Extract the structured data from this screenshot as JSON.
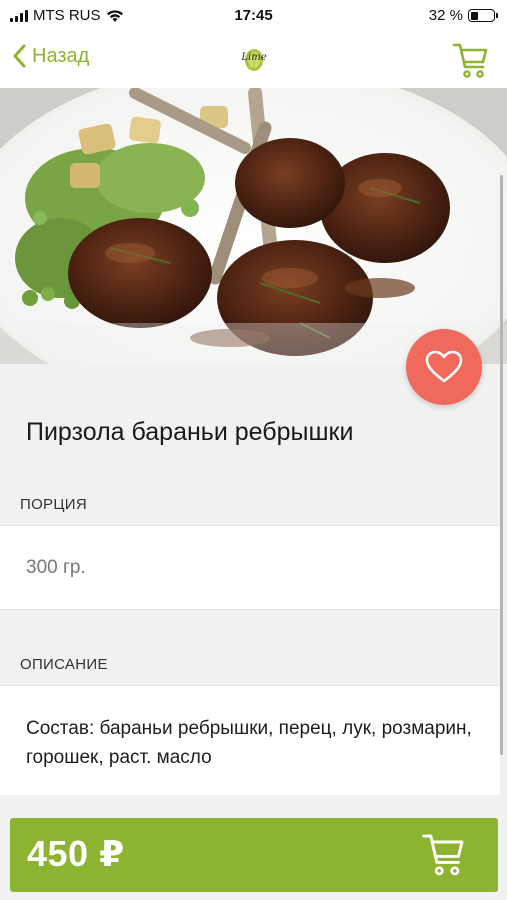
{
  "status_bar": {
    "carrier": "MTS RUS",
    "time": "17:45",
    "battery": "32 %",
    "battery_level": 0.32
  },
  "nav": {
    "back_label": "Назад",
    "logo_text": "Lime"
  },
  "product": {
    "title": "Пирзола бараньи ребрышки",
    "portion_label": "ПОРЦИЯ",
    "portion_value": "300 гр.",
    "description_label": "ОПИСАНИЕ",
    "description_value": "Состав: бараньи ребрышки, перец, лук, розмарин, горошек, раст. масло",
    "price": "450 ₽"
  },
  "colors": {
    "accent": "#8cb430",
    "favorite": "#ef6a5c"
  },
  "icons": [
    "wifi-icon",
    "back-chevron-icon",
    "cart-icon",
    "heart-icon"
  ]
}
